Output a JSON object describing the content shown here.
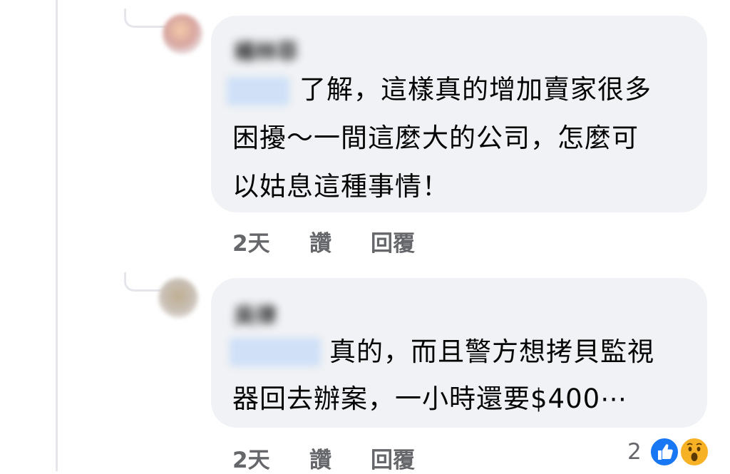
{
  "comments": [
    {
      "author": "楊林菲",
      "mention": "許小姐",
      "lines": [
        "了解，這樣真的增加賣家很多",
        "困擾～一間這麼大的公司，怎麼可",
        "以姑息這種事情！"
      ],
      "time": "2天",
      "like_label": "讚",
      "reply_label": "回覆"
    },
    {
      "author": "吳律",
      "mention": "楊林菲",
      "lines": [
        "真的，而且警方想拷貝監視",
        "器回去辦案，一小時還要$400⋯"
      ],
      "time": "2天",
      "like_label": "讚",
      "reply_label": "回覆",
      "reaction_count": "2",
      "reactions": [
        "like-icon",
        "wow-icon"
      ]
    }
  ],
  "colors": {
    "bubble": "#f0f2f5",
    "meta_text": "#65676b",
    "like_blue": "#1877f2",
    "wow_yellow": "#f7b125",
    "thread_line": "#e4e6eb"
  }
}
